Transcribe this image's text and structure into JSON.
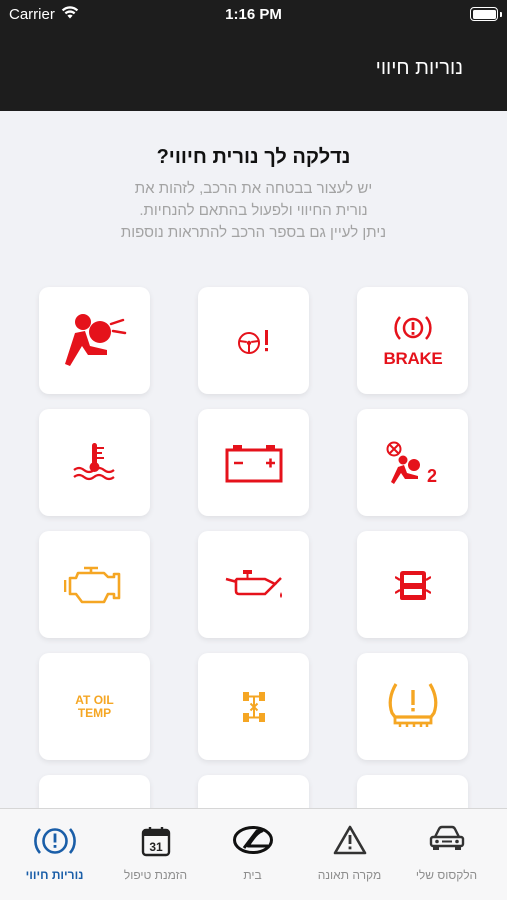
{
  "status_bar": {
    "carrier": "Carrier",
    "time": "1:16 PM"
  },
  "header": {
    "title": "נוריות חיווי"
  },
  "intro": {
    "heading": "נדלקה לך נורית חיווי?",
    "lines": [
      "יש לעצור בבטחה את הרכב, לזהות את",
      "נורית החיווי ולפעול בהתאם להנחיות.",
      "ניתן לעיין גם בספר הרכב להתראות נוספות"
    ]
  },
  "warning_tiles": [
    {
      "icon": "brake-warning-icon",
      "text": "BRAKE",
      "color": "#e5121b"
    },
    {
      "icon": "steering-warning-icon",
      "color": "#e5121b"
    },
    {
      "icon": "airbag-warning-icon",
      "color": "#e5121b"
    },
    {
      "icon": "passenger-airbag-off-icon",
      "text": "2",
      "color": "#e5121b"
    },
    {
      "icon": "battery-warning-icon",
      "color": "#e5121b"
    },
    {
      "icon": "coolant-temperature-icon",
      "color": "#e5121b"
    },
    {
      "icon": "door-open-icon",
      "color": "#e5121b"
    },
    {
      "icon": "oil-pressure-icon",
      "color": "#e5121b"
    },
    {
      "icon": "check-engine-icon",
      "color": "#f5a623"
    },
    {
      "icon": "tire-pressure-icon",
      "color": "#f5a623"
    },
    {
      "icon": "four-wheel-drive-icon",
      "color": "#f5a623"
    },
    {
      "icon": "at-oil-temp-icon",
      "text_line1": "AT OIL",
      "text_line2": "TEMP",
      "color": "#f5a623"
    }
  ],
  "tabbar": {
    "tabs": [
      {
        "label": "הלקסוס שלי",
        "icon": "car-icon",
        "active": false
      },
      {
        "label": "מקרה תאונה",
        "icon": "warning-triangle-icon",
        "active": false
      },
      {
        "label": "בית",
        "icon": "lexus-logo-icon",
        "active": false
      },
      {
        "label": "הזמנת טיפול",
        "icon": "calendar-icon",
        "active": false,
        "calendar_day": "31"
      },
      {
        "label": "נוריות חיווי",
        "icon": "warning-light-icon",
        "active": true
      }
    ]
  },
  "colors": {
    "header_bg": "#1d1d1d",
    "page_bg": "#f1f2f6",
    "accent": "#1a5ea8",
    "red_warning": "#e5121b",
    "amber_warning": "#f5a623"
  }
}
